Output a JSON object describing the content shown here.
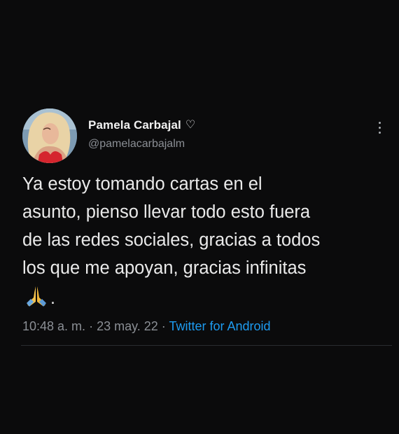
{
  "tweet": {
    "display_name": "Pamela Carbajal",
    "verified_heart": "♡",
    "handle": "@pamelacarbajalm",
    "text_lines": [
      "Ya estoy tomando cartas en el",
      "asunto, pienso llevar todo esto fuera",
      "de las redes sociales, gracias a todos",
      "los que me apoyan, gracias infinitas"
    ],
    "emoji": "pray-emoji",
    "emoji_trailing": ".",
    "time": "10:48 a. m.",
    "separator": " · ",
    "date": "23 may. 22",
    "source": "Twitter for Android"
  },
  "colors": {
    "background": "#0b0b0c",
    "text": "#eaeaea",
    "secondary": "#8b8f95",
    "link": "#1d9bf0"
  }
}
